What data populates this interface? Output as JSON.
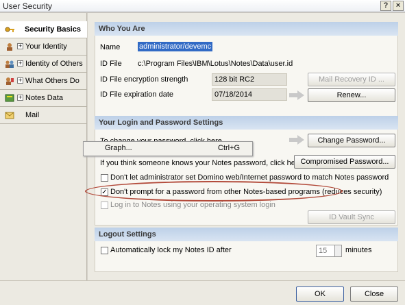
{
  "window": {
    "title": "User Security",
    "help_label": "?",
    "close_label": "×"
  },
  "sidebar": {
    "items": [
      {
        "label": "Security Basics",
        "expandable": false,
        "active": true
      },
      {
        "label": "Your Identity",
        "expandable": true,
        "active": false
      },
      {
        "label": "Identity of Others",
        "expandable": true,
        "active": false
      },
      {
        "label": "What Others Do",
        "expandable": true,
        "active": false
      },
      {
        "label": "Notes Data",
        "expandable": true,
        "active": false
      },
      {
        "label": "Mail",
        "expandable": false,
        "active": false
      }
    ],
    "plus_glyph": "+"
  },
  "who": {
    "header": "Who You Are",
    "name_label": "Name",
    "name_value": "administrator/devemc",
    "id_file_label": "ID File",
    "id_file_value": "c:\\Program Files\\IBM\\Lotus\\Notes\\Data\\user.id",
    "enc_label": "ID File encryption strength",
    "enc_value": "128 bit RC2",
    "exp_label": "ID File expiration date",
    "exp_value": "07/18/2014",
    "mail_recovery_button": "Mail Recovery ID ...",
    "renew_button": "Renew..."
  },
  "login": {
    "header": "Your Login and Password Settings",
    "change_text": "To change your password, click here",
    "change_button": "Change Password...",
    "compromised_text": "If you think someone knows your Notes password, click here",
    "compromised_button": "Compromised Password...",
    "opt1_label": "Don't let administrator set Domino web/Internet password to match Notes password",
    "opt1_checked": false,
    "opt2_label": "Don't prompt for a password from other Notes-based programs (reduces security)",
    "opt2_checked": true,
    "opt3_label": "Log in to Notes using your operating system login",
    "opt3_checked": false,
    "vault_button": "ID Vault Sync"
  },
  "logout": {
    "header": "Logout Settings",
    "auto_lock_label": "Automatically lock my Notes ID after",
    "auto_lock_checked": false,
    "minutes_value": "15",
    "minutes_label": "minutes"
  },
  "context_menu": {
    "item_label": "Graph...",
    "shortcut": "Ctrl+G"
  },
  "footer": {
    "ok_button": "OK",
    "close_button": "Close"
  },
  "colors": {
    "header_bg": "#c8d7ec",
    "highlight": "#316ac5",
    "annotation_oval": "#b24a3a"
  },
  "check_glyph": "✓"
}
